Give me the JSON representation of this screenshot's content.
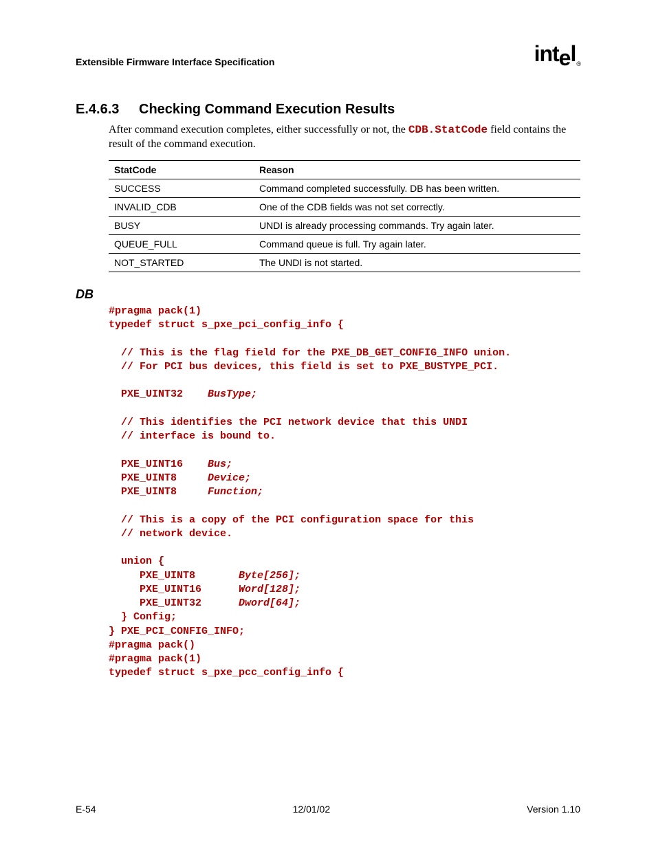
{
  "header": {
    "doc_title": "Extensible Firmware Interface Specification",
    "logo_text_1": "int",
    "logo_text_2": "e",
    "logo_text_3": "l",
    "logo_reg": "®"
  },
  "section": {
    "number": "E.4.6.3",
    "title": "Checking Command Execution Results"
  },
  "para": {
    "p1a": "After command execution completes, either successfully or not, the ",
    "p1code": "CDB.StatCode",
    "p1b": " field contains the result of the command execution."
  },
  "table": {
    "head": {
      "c1": "StatCode",
      "c2": "Reason"
    },
    "rows": [
      {
        "c1": "SUCCESS",
        "c2": "Command completed successfully.  DB has been written."
      },
      {
        "c1": "INVALID_CDB",
        "c2": "One of the CDB fields was not set correctly."
      },
      {
        "c1": "BUSY",
        "c2": "UNDI is already processing commands.  Try again later."
      },
      {
        "c1": "QUEUE_FULL",
        "c2": "Command queue is full.  Try again later."
      },
      {
        "c1": "NOT_STARTED",
        "c2": "The UNDI is not started."
      }
    ]
  },
  "db_heading": "DB",
  "code": {
    "l01": "#pragma pack(1)",
    "l02": "typedef struct s_pxe_pci_config_info {",
    "l03": "",
    "l04": "  // This is the flag field for the PXE_DB_GET_CONFIG_INFO union.",
    "l05": "  // For PCI bus devices, this field is set to PXE_BUSTYPE_PCI.",
    "l06": "",
    "l07a": "  PXE_UINT32    ",
    "l07b": "BusType;",
    "l08": "",
    "l09": "  // This identifies the PCI network device that this UNDI",
    "l10": "  // interface is bound to.",
    "l11": "",
    "l12a": "  PXE_UINT16    ",
    "l12b": "Bus;",
    "l13a": "  PXE_UINT8     ",
    "l13b": "Device;",
    "l14a": "  PXE_UINT8     ",
    "l14b": "Function;",
    "l15": "",
    "l16": "  // This is a copy of the PCI configuration space for this",
    "l17": "  // network device.",
    "l18": "",
    "l19": "  union {",
    "l20a": "     PXE_UINT8       ",
    "l20b": "Byte[256];",
    "l21a": "     PXE_UINT16      ",
    "l21b": "Word[128];",
    "l22a": "     PXE_UINT32      ",
    "l22b": "Dword[64];",
    "l23": "  } Config;",
    "l24": "} PXE_PCI_CONFIG_INFO;",
    "l25": "#pragma pack()",
    "l26": "#pragma pack(1)",
    "l27": "typedef struct s_pxe_pcc_config_info {"
  },
  "footer": {
    "left": "E-54",
    "center": "12/01/02",
    "right": "Version 1.10"
  }
}
